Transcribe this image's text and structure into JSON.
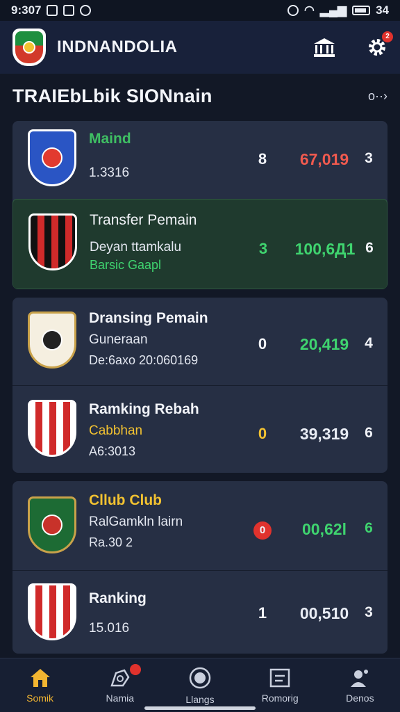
{
  "status_bar": {
    "time": "9:307",
    "battery": "34"
  },
  "app": {
    "title": "INDNANDOLIA"
  },
  "section": {
    "title": "TRAIEbLbik SIONnain",
    "more": "o··›"
  },
  "items": [
    {
      "title": "Maind",
      "line1": "1.3316",
      "line2": "",
      "count": "8",
      "value": "67,019",
      "rank": "3",
      "title_color": "#3fbf63",
      "value_color": "#f05a4f",
      "count_color": "#f1f3f8"
    },
    {
      "title": "Transfer Pemain",
      "line1": "Deyan ttamkalu",
      "line2": "Barsic Gaapl",
      "count": "3",
      "value": "100,6Д1",
      "rank": "6",
      "title_color": "#f1f3f8",
      "value_color": "#3fd46f",
      "count_color": "#3fd46f"
    },
    {
      "title": "Dransing Pemain",
      "line1": "Guneraan",
      "line2": "De:6axo  20:060169",
      "count": "0",
      "value": "20,419",
      "rank": "4",
      "title_color": "#f1f3f8",
      "value_color": "#3fd46f",
      "count_color": "#f1f3f8"
    },
    {
      "title": "Ramking Rebah",
      "line1": "Cabbhan",
      "line2": "A6:3013",
      "count": "0",
      "value": "39,319",
      "rank": "6",
      "title_color": "#f1f3f8",
      "value_color": "#f1f3f8",
      "count_color": "#f2c231"
    },
    {
      "title": "Cllub Club",
      "line1": "RalGamkln lairn",
      "line2": "Ra.30 2",
      "count": "0",
      "value": "00,62l",
      "rank": "6",
      "title_color": "#f2c231",
      "value_color": "#3fd46f",
      "count_color": "#ffffff"
    },
    {
      "title": "Ranking",
      "line1": "15.016",
      "line2": "",
      "count": "1",
      "value": "00,510",
      "rank": "3",
      "title_color": "#f1f3f8",
      "value_color": "#f1f3f8",
      "count_color": "#f1f3f8"
    }
  ],
  "nav": [
    {
      "label": "Somik",
      "icon": "home-icon"
    },
    {
      "label": "Namia",
      "icon": "transfer-icon"
    },
    {
      "label": "Llangs",
      "icon": "ball-icon"
    },
    {
      "label": "Romorig",
      "icon": "board-icon"
    },
    {
      "label": "Denos",
      "icon": "profile-icon"
    }
  ],
  "colors": {
    "accent": "#f2b531",
    "positive": "#3fd46f",
    "negative": "#f05a4f",
    "badge": "#e0322d"
  }
}
